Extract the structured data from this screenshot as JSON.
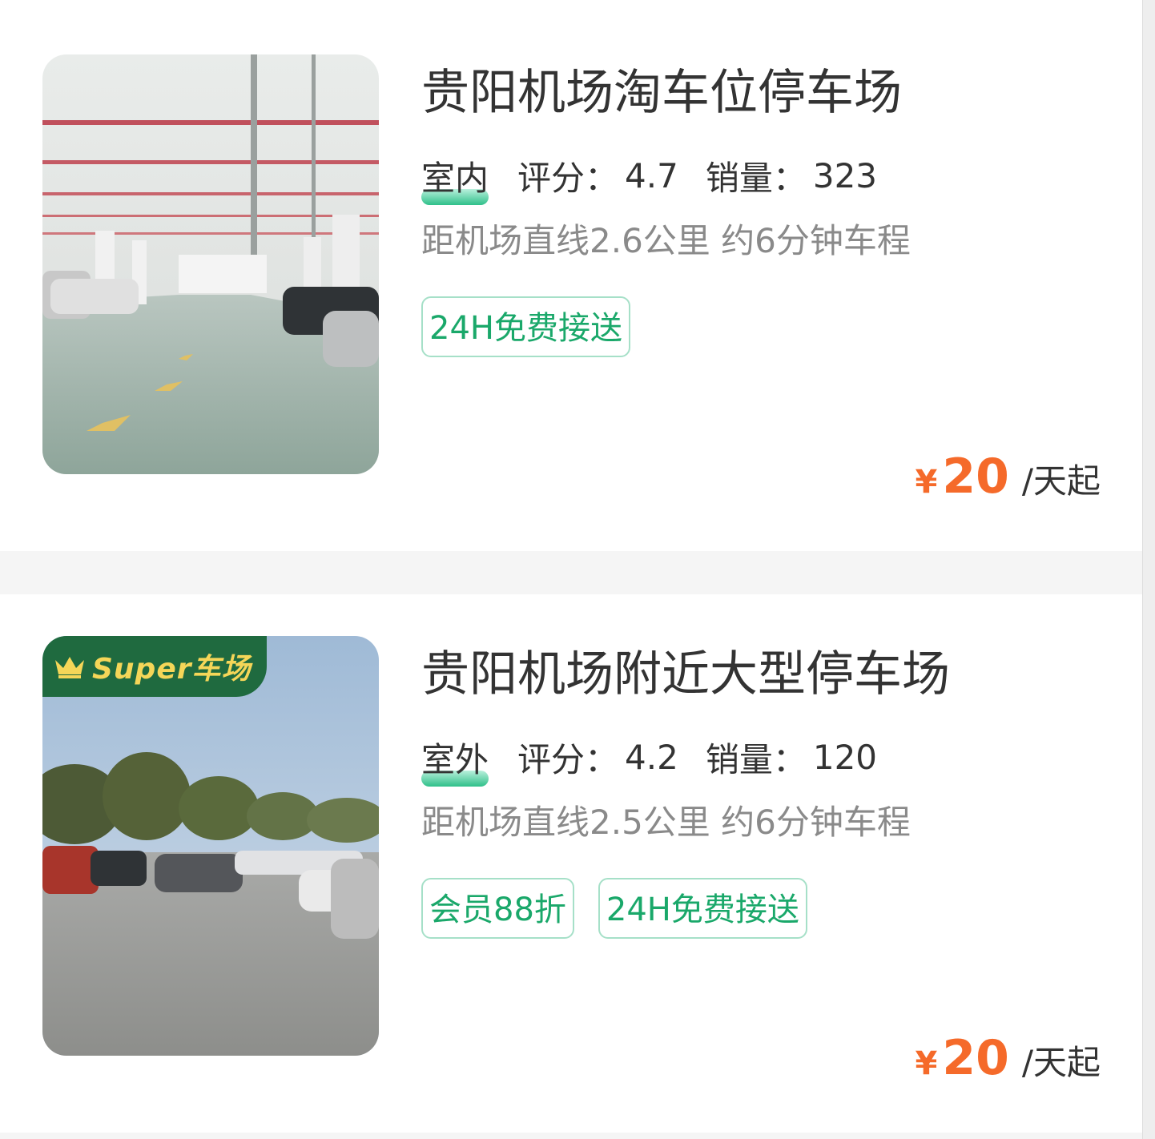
{
  "parking_lots": [
    {
      "name": "贵阳机场淘车位停车场",
      "type": "室内",
      "rating_label": "评分：",
      "rating": "4.7",
      "sales_label": "销量：",
      "sales": "323",
      "distance": "距机场直线2.6公里 约6分钟车程",
      "tags": [
        "24H免费接送"
      ],
      "price_currency": "¥",
      "price": "20",
      "price_unit": "/天起",
      "image": "indoor-garage-photo"
    },
    {
      "badge": "Super车场",
      "name": "贵阳机场附近大型停车场",
      "type": "室外",
      "rating_label": "评分：",
      "rating": "4.2",
      "sales_label": "销量：",
      "sales": "120",
      "distance": "距机场直线2.5公里 约6分钟车程",
      "tags": [
        "会员88折",
        "24H免费接送"
      ],
      "price_currency": "¥",
      "price": "20",
      "price_unit": "/天起",
      "image": "outdoor-lot-photo"
    }
  ],
  "colors": {
    "accent_green": "#1aa86a",
    "price_orange": "#f56a2a",
    "badge_green": "#1f6a3f",
    "badge_gold": "#f5d658"
  }
}
